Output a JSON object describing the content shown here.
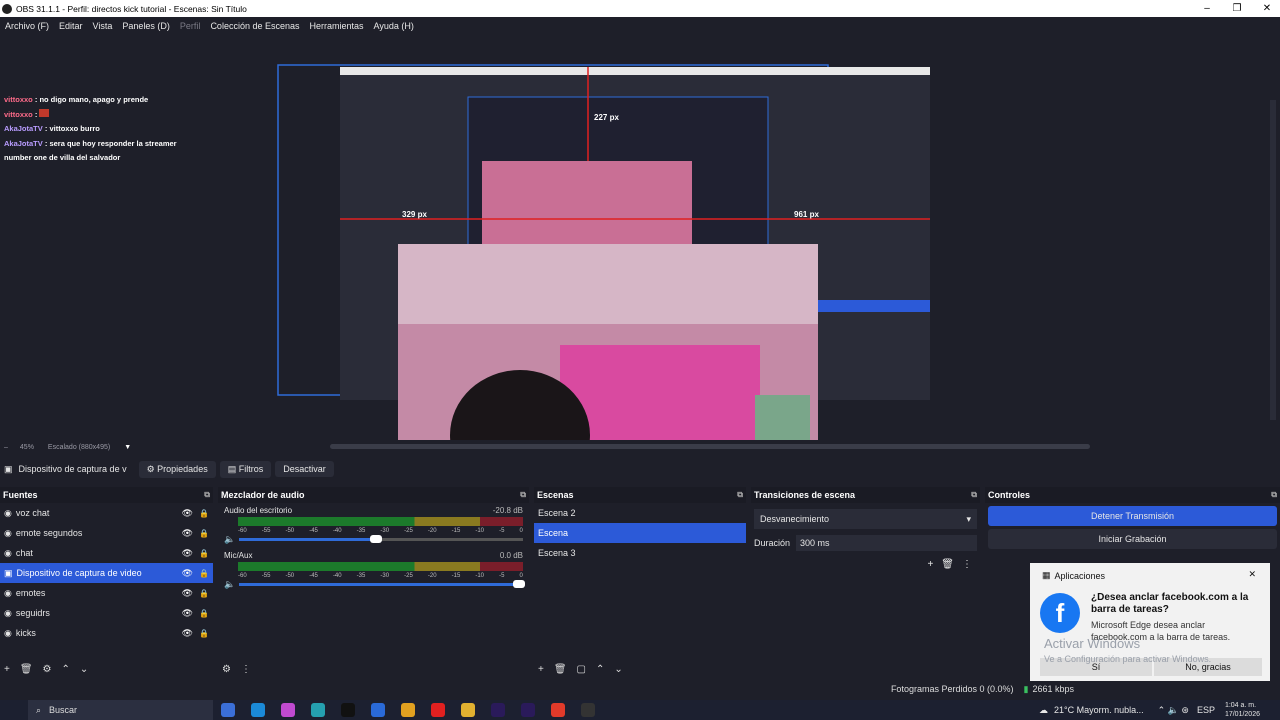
{
  "window": {
    "title": "OBS 31.1.1 - Perfil: directos kick tutorial - Escenas: Sin Título"
  },
  "menu": [
    "Archivo (F)",
    "Editar",
    "Vista",
    "Paneles (D)",
    "Perfil",
    "Colección de Escenas",
    "Herramientas",
    "Ayuda (H)"
  ],
  "chat": [
    {
      "user": "vittoxxo",
      "text": "no digo mano, apago y prende"
    },
    {
      "user": "vittoxxo",
      "text": ""
    },
    {
      "user": "AkaJotaTV",
      "text": "vittoxxo burro"
    },
    {
      "user": "AkaJotaTV",
      "text": "sera que hoy responder la streamer number one de villa del salvador"
    }
  ],
  "preview": {
    "label_left": "329 px",
    "label_right": "961 px",
    "label_top": "227 px"
  },
  "canvas": {
    "zoom": "45%",
    "scale": "Escalado (880x495)"
  },
  "sourcebar": {
    "name": "Dispositivo de captura de v",
    "props": "Propiedades",
    "filters": "Filtros",
    "deactivate": "Desactivar"
  },
  "sources": {
    "title": "Fuentes",
    "items": [
      "voz chat",
      "emote segundos",
      "chat",
      "Dispositivo de captura de video",
      "emotes",
      "seguidrs",
      "kicks"
    ]
  },
  "mixer": {
    "title": "Mezclador de audio",
    "ch1": {
      "name": "Audio del escritorio",
      "db": "-20.8 dB"
    },
    "ch2": {
      "name": "Mic/Aux",
      "db": "0.0 dB"
    },
    "ticks": [
      "-60",
      "-55",
      "-50",
      "-45",
      "-40",
      "-35",
      "-30",
      "-25",
      "-20",
      "-15",
      "-10",
      "-5",
      "0"
    ]
  },
  "scenes": {
    "title": "Escenas",
    "items": [
      "Escena 2",
      "Escena",
      "Escena 3"
    ]
  },
  "transitions": {
    "title": "Transiciones de escena",
    "type": "Desvanecimiento",
    "duration_label": "Duración",
    "duration": "300 ms"
  },
  "controls": {
    "title": "Controles",
    "stop_stream": "Detener Transmisión",
    "start_rec": "Iniciar Grabación"
  },
  "status": {
    "dropped": "Fotogramas Perdidos 0 (0.0%)",
    "bitrate": "2661 kbps"
  },
  "toast": {
    "app": "Aplicaciones",
    "title": "¿Desea anclar facebook.com a la barra de tareas?",
    "body": "Microsoft Edge desea anclar facebook.com a la barra de tareas.",
    "yes": "Sí",
    "no": "No, gracias"
  },
  "watermark": {
    "line1": "Activar Windows",
    "line2": "Ve a Configuración para activar Windows."
  },
  "taskbar": {
    "search": "Buscar",
    "weather": "21°C  Mayorm. nubla...",
    "lang": "ESP",
    "time": "1:04 a. m.",
    "date": "17/01/2026"
  }
}
